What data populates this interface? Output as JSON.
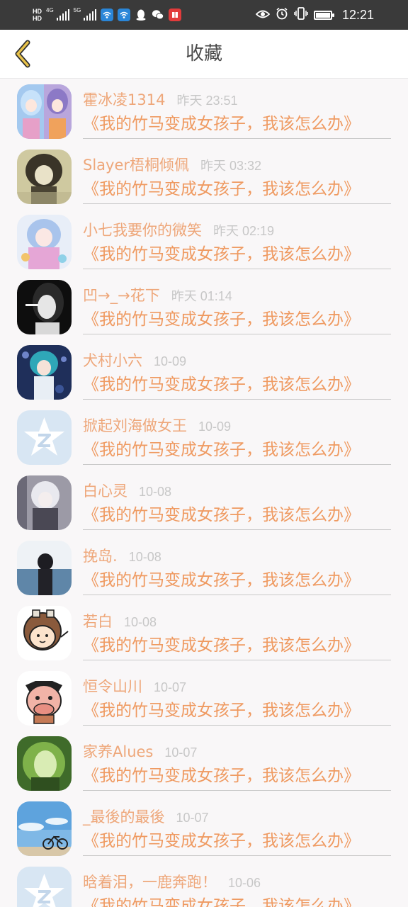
{
  "status_bar": {
    "hd1": "HD",
    "hd2": "HD",
    "net1": "4G",
    "net2": "5G",
    "time": "12:21",
    "icons": [
      "hd-icon",
      "signal-icon",
      "wifi-hotspot-icon",
      "qq-icon",
      "wechat-icon",
      "book-app-icon",
      "eye-icon",
      "alarm-icon",
      "vibrate-icon",
      "battery-icon"
    ]
  },
  "header": {
    "title": "收藏",
    "back_icon": "chevron-left-icon",
    "accent_color": "#e9c34a"
  },
  "colors": {
    "name": "#eea77a",
    "book": "#ef9a61",
    "time": "#c7c7c7"
  },
  "items": [
    {
      "name": "霍冰凌1314",
      "time": "昨天 23:51",
      "book": "《我的竹马变成女孩子，我该怎么办》",
      "avatar": "anime-girls-avatar"
    },
    {
      "name": "Slayer梧桐倾佩",
      "time": "昨天 03:32",
      "book": "《我的竹马变成女孩子，我该怎么办》",
      "avatar": "dark-anime-avatar"
    },
    {
      "name": "小七我要你的微笑",
      "time": "昨天 02:19",
      "book": "《我的竹马变成女孩子，我该怎么办》",
      "avatar": "pastel-anime-avatar"
    },
    {
      "name": "凹→_→花下",
      "time": "昨天 01:14",
      "book": "《我的竹马变成女孩子，我该怎么办》",
      "avatar": "bw-portrait-avatar"
    },
    {
      "name": "犬村小六",
      "time": "10-09",
      "book": "《我的竹马变成女孩子，我该怎么办》",
      "avatar": "blue-anime-avatar"
    },
    {
      "name": "掀起刘海做女王",
      "time": "10-09",
      "book": "《我的竹马变成女孩子，我该怎么办》",
      "avatar": "default-star-avatar"
    },
    {
      "name": "白心灵",
      "time": "10-08",
      "book": "《我的竹马变成女孩子，我该怎么办》",
      "avatar": "grey-anime-avatar"
    },
    {
      "name": "挽岛.",
      "time": "10-08",
      "book": "《我的竹马变成女孩子，我该怎么办》",
      "avatar": "sea-girl-avatar"
    },
    {
      "name": "若白",
      "time": "10-08",
      "book": "《我的竹马变成女孩子，我该怎么办》",
      "avatar": "cartoon-boy-avatar"
    },
    {
      "name": "恒令山川",
      "time": "10-07",
      "book": "《我的竹马变成女孩子，我该怎么办》",
      "avatar": "cow-avatar"
    },
    {
      "name": "家养Alues",
      "time": "10-07",
      "book": "《我的竹马变成女孩子，我该怎么办》",
      "avatar": "green-anime-avatar"
    },
    {
      "name": "_最後的最後",
      "time": "10-07",
      "book": "《我的竹马变成女孩子，我该怎么办》",
      "avatar": "sky-bicycle-avatar"
    },
    {
      "name": "晗着泪，一鹿奔跑！",
      "time": "10-06",
      "book": "《我的竹马变成女孩子，我该怎么办》",
      "avatar": "default-star-avatar"
    }
  ]
}
